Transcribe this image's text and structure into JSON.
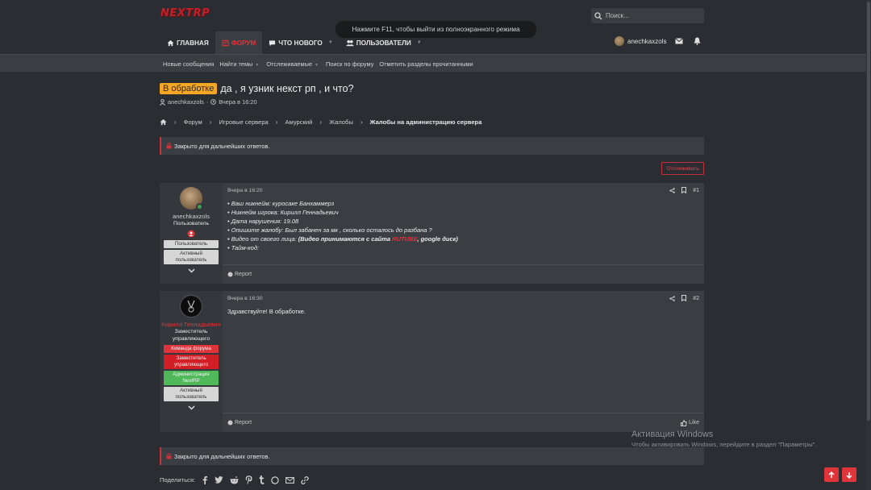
{
  "header": {
    "logo": "NEXTRP",
    "search_placeholder": "Поиск...",
    "fullscreen_message": "Нажмите F11, чтобы выйти из полноэкранного режима",
    "nav": [
      {
        "label": "Главная",
        "icon": "home-icon"
      },
      {
        "label": "Форум",
        "icon": "forum-icon",
        "active": true
      },
      {
        "label": "Что нового",
        "icon": "chat-icon",
        "dropdown": true
      },
      {
        "label": "Пользователи",
        "icon": "users-icon",
        "dropdown": true
      }
    ],
    "username": "anechkaxzols"
  },
  "subnav": {
    "items": [
      {
        "label": "Новые сообщения"
      },
      {
        "label": "Найти темы",
        "dropdown": true
      },
      {
        "label": "Отслеживаемые",
        "dropdown": true
      },
      {
        "label": "Поиск по форуму"
      },
      {
        "label": "Отметить разделы прочитанными"
      }
    ]
  },
  "thread": {
    "prefix": "В обработке",
    "title": "да , я узник некст рп , и что?",
    "author": "anechkaxzols",
    "date": "Вчера в 16:20"
  },
  "breadcrumb": [
    "Форум",
    "Игровые сервера",
    "Амурский",
    "Жалобы",
    "Жалобы на администрацию сервера"
  ],
  "notices": {
    "closed": "Закрыто для дальнейших ответов."
  },
  "watch_button": "Отслеживать",
  "posts": [
    {
      "username": "anechkaxzols",
      "user_title": "Пользователь",
      "badges": [
        "Пользователь",
        "Активный пользователь"
      ],
      "date": "Вчера в 16:20",
      "number": "#1",
      "lines": [
        "• Ваш никнейм: куросаке Банхаммерз",
        "• Никнейм игрока: Кирилл Геннадьевич",
        "• Дата нарушения: 19.08",
        "• Опишите жалобу: Был забанен за мк , сколько осталось до разбана ?"
      ],
      "video_line": {
        "prefix": "• Видео от своего лица: ",
        "bold_start": "(Видео принимаются с сайта ",
        "rutube": "RUTUBE",
        "bold_end": ", google диск)"
      },
      "timecode_line": "• Тайм-код:",
      "report": "Report"
    },
    {
      "username": "Кирилл Геннадьевич",
      "user_title": "Заместитель управляющего",
      "badges": [
        "Команда форума",
        "Заместитель управляющего",
        "Администрация NextRP",
        "Активный пользователь"
      ],
      "date": "Вчера в 16:30",
      "number": "#2",
      "text": "Здравствуйте! В обработке.",
      "report": "Report",
      "like": "Like"
    }
  ],
  "share": {
    "label": "Поделиться:"
  },
  "watermark": {
    "title": "Активация Windows",
    "subtitle": "Чтобы активировать Windows, перейдите в раздел \"Параметры\"."
  },
  "colors": {
    "accent": "#e0343b",
    "prefix": "#f5a623",
    "background": "#2a2d31",
    "panel": "#3a3d42"
  }
}
